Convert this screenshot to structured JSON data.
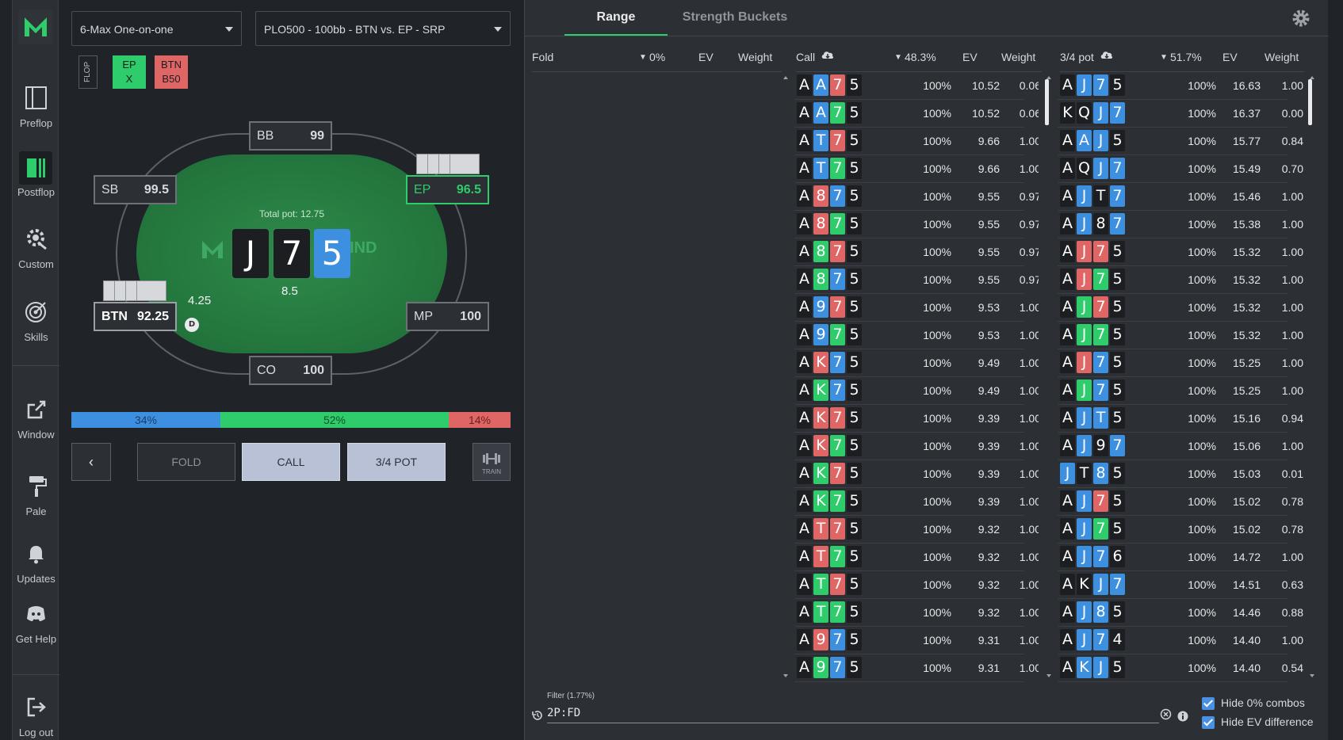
{
  "sidebar": {
    "items": [
      {
        "label": "Preflop",
        "icon": "book-icon"
      },
      {
        "label": "Postflop",
        "icon": "postflop-icon"
      },
      {
        "label": "Custom",
        "icon": "custom-gear-icon"
      },
      {
        "label": "Skills",
        "icon": "target-icon"
      },
      {
        "label": "Window",
        "icon": "external-window-icon"
      },
      {
        "label": "Pale",
        "icon": "paint-roller-icon"
      },
      {
        "label": "Updates",
        "icon": "bell-icon"
      },
      {
        "label": "Get Help",
        "icon": "discord-icon"
      },
      {
        "label": "Log out",
        "icon": "logout-icon"
      }
    ]
  },
  "selectors": {
    "game": "6-Max One-on-one",
    "spot": "PLO500 - 100bb - BTN vs. EP - SRP"
  },
  "street_tag": "FLOP",
  "action_tags": [
    {
      "line1": "EP",
      "line2": "X",
      "color": "#2ecc6a"
    },
    {
      "line1": "BTN",
      "line2": "B50",
      "color": "#e06666"
    }
  ],
  "table": {
    "logo_text": "IND",
    "pot_label": "Total pot: 12.75",
    "main_bet": "8.5",
    "btn_bet": "4.25",
    "dealer_label": "D",
    "seats": {
      "bb": {
        "name": "BB",
        "stack": "99"
      },
      "sb": {
        "name": "SB",
        "stack": "99.5"
      },
      "ep": {
        "name": "EP",
        "stack": "96.5"
      },
      "btn": {
        "name": "BTN",
        "stack": "92.25"
      },
      "mp": {
        "name": "MP",
        "stack": "100"
      },
      "co": {
        "name": "CO",
        "stack": "100"
      }
    },
    "board": [
      {
        "rank": "J",
        "color": "#1c1e21"
      },
      {
        "rank": "7",
        "color": "#1c1e21"
      },
      {
        "rank": "5",
        "color": "#3d8fe0"
      }
    ]
  },
  "frequency": [
    {
      "label": "34%",
      "value": 34,
      "color": "#3d8fe0",
      "text_color": "#1b3d66"
    },
    {
      "label": "52%",
      "value": 52,
      "color": "#2ecc6a",
      "text_color": "#13502a"
    },
    {
      "label": "14%",
      "value": 14,
      "color": "#e06666",
      "text_color": "#6a1f1f"
    }
  ],
  "actions": {
    "fold": "FOLD",
    "call": "CALL",
    "bet": "3/4 POT",
    "train": "TRAIN"
  },
  "tabs": {
    "range": "Range",
    "buckets": "Strength Buckets"
  },
  "columns": {
    "fold": {
      "title": "Fold",
      "freq": "0%",
      "ev": "EV",
      "weight": "Weight"
    },
    "call": {
      "title": "Call",
      "freq": "48.3%",
      "ev": "EV",
      "weight": "Weight"
    },
    "bet": {
      "title": "3/4 pot",
      "freq": "51.7%",
      "ev": "EV",
      "weight": "Weight"
    }
  },
  "suit_colors": {
    "s": "#1c1e21",
    "h": "#e06666",
    "d": "#3d8fe0",
    "c": "#2ecc6a"
  },
  "call_rows": [
    {
      "cards": [
        [
          "A",
          "s"
        ],
        [
          "A",
          "d"
        ],
        [
          "7",
          "h"
        ],
        [
          "5",
          "s"
        ]
      ],
      "freq": "100%",
      "ev": "10.52",
      "weight": "0.06"
    },
    {
      "cards": [
        [
          "A",
          "s"
        ],
        [
          "A",
          "d"
        ],
        [
          "7",
          "c"
        ],
        [
          "5",
          "s"
        ]
      ],
      "freq": "100%",
      "ev": "10.52",
      "weight": "0.06"
    },
    {
      "cards": [
        [
          "A",
          "s"
        ],
        [
          "T",
          "d"
        ],
        [
          "7",
          "h"
        ],
        [
          "5",
          "s"
        ]
      ],
      "freq": "100%",
      "ev": "9.66",
      "weight": "1.00"
    },
    {
      "cards": [
        [
          "A",
          "s"
        ],
        [
          "T",
          "d"
        ],
        [
          "7",
          "c"
        ],
        [
          "5",
          "s"
        ]
      ],
      "freq": "100%",
      "ev": "9.66",
      "weight": "1.00"
    },
    {
      "cards": [
        [
          "A",
          "s"
        ],
        [
          "8",
          "h"
        ],
        [
          "7",
          "d"
        ],
        [
          "5",
          "s"
        ]
      ],
      "freq": "100%",
      "ev": "9.55",
      "weight": "0.97"
    },
    {
      "cards": [
        [
          "A",
          "s"
        ],
        [
          "8",
          "h"
        ],
        [
          "7",
          "c"
        ],
        [
          "5",
          "s"
        ]
      ],
      "freq": "100%",
      "ev": "9.55",
      "weight": "0.97"
    },
    {
      "cards": [
        [
          "A",
          "s"
        ],
        [
          "8",
          "c"
        ],
        [
          "7",
          "h"
        ],
        [
          "5",
          "s"
        ]
      ],
      "freq": "100%",
      "ev": "9.55",
      "weight": "0.97"
    },
    {
      "cards": [
        [
          "A",
          "s"
        ],
        [
          "8",
          "c"
        ],
        [
          "7",
          "d"
        ],
        [
          "5",
          "s"
        ]
      ],
      "freq": "100%",
      "ev": "9.55",
      "weight": "0.97"
    },
    {
      "cards": [
        [
          "A",
          "s"
        ],
        [
          "9",
          "d"
        ],
        [
          "7",
          "h"
        ],
        [
          "5",
          "s"
        ]
      ],
      "freq": "100%",
      "ev": "9.53",
      "weight": "1.00"
    },
    {
      "cards": [
        [
          "A",
          "s"
        ],
        [
          "9",
          "d"
        ],
        [
          "7",
          "c"
        ],
        [
          "5",
          "s"
        ]
      ],
      "freq": "100%",
      "ev": "9.53",
      "weight": "1.00"
    },
    {
      "cards": [
        [
          "A",
          "s"
        ],
        [
          "K",
          "h"
        ],
        [
          "7",
          "d"
        ],
        [
          "5",
          "s"
        ]
      ],
      "freq": "100%",
      "ev": "9.49",
      "weight": "1.00"
    },
    {
      "cards": [
        [
          "A",
          "s"
        ],
        [
          "K",
          "c"
        ],
        [
          "7",
          "d"
        ],
        [
          "5",
          "s"
        ]
      ],
      "freq": "100%",
      "ev": "9.49",
      "weight": "1.00"
    },
    {
      "cards": [
        [
          "A",
          "s"
        ],
        [
          "K",
          "h"
        ],
        [
          "7",
          "h"
        ],
        [
          "5",
          "s"
        ]
      ],
      "freq": "100%",
      "ev": "9.39",
      "weight": "1.00"
    },
    {
      "cards": [
        [
          "A",
          "s"
        ],
        [
          "K",
          "h"
        ],
        [
          "7",
          "c"
        ],
        [
          "5",
          "s"
        ]
      ],
      "freq": "100%",
      "ev": "9.39",
      "weight": "1.00"
    },
    {
      "cards": [
        [
          "A",
          "s"
        ],
        [
          "K",
          "c"
        ],
        [
          "7",
          "h"
        ],
        [
          "5",
          "s"
        ]
      ],
      "freq": "100%",
      "ev": "9.39",
      "weight": "1.00"
    },
    {
      "cards": [
        [
          "A",
          "s"
        ],
        [
          "K",
          "c"
        ],
        [
          "7",
          "c"
        ],
        [
          "5",
          "s"
        ]
      ],
      "freq": "100%",
      "ev": "9.39",
      "weight": "1.00"
    },
    {
      "cards": [
        [
          "A",
          "s"
        ],
        [
          "T",
          "h"
        ],
        [
          "7",
          "h"
        ],
        [
          "5",
          "s"
        ]
      ],
      "freq": "100%",
      "ev": "9.32",
      "weight": "1.00"
    },
    {
      "cards": [
        [
          "A",
          "s"
        ],
        [
          "T",
          "h"
        ],
        [
          "7",
          "c"
        ],
        [
          "5",
          "s"
        ]
      ],
      "freq": "100%",
      "ev": "9.32",
      "weight": "1.00"
    },
    {
      "cards": [
        [
          "A",
          "s"
        ],
        [
          "T",
          "c"
        ],
        [
          "7",
          "h"
        ],
        [
          "5",
          "s"
        ]
      ],
      "freq": "100%",
      "ev": "9.32",
      "weight": "1.00"
    },
    {
      "cards": [
        [
          "A",
          "s"
        ],
        [
          "T",
          "c"
        ],
        [
          "7",
          "c"
        ],
        [
          "5",
          "s"
        ]
      ],
      "freq": "100%",
      "ev": "9.32",
      "weight": "1.00"
    },
    {
      "cards": [
        [
          "A",
          "s"
        ],
        [
          "9",
          "h"
        ],
        [
          "7",
          "d"
        ],
        [
          "5",
          "s"
        ]
      ],
      "freq": "100%",
      "ev": "9.31",
      "weight": "1.00"
    },
    {
      "cards": [
        [
          "A",
          "s"
        ],
        [
          "9",
          "c"
        ],
        [
          "7",
          "d"
        ],
        [
          "5",
          "s"
        ]
      ],
      "freq": "100%",
      "ev": "9.31",
      "weight": "1.00"
    }
  ],
  "bet_rows": [
    {
      "cards": [
        [
          "A",
          "s"
        ],
        [
          "J",
          "d"
        ],
        [
          "7",
          "d"
        ],
        [
          "5",
          "s"
        ]
      ],
      "freq": "100%",
      "ev": "16.63",
      "weight": "1.00"
    },
    {
      "cards": [
        [
          "K",
          "s"
        ],
        [
          "Q",
          "s"
        ],
        [
          "J",
          "d"
        ],
        [
          "7",
          "d"
        ]
      ],
      "freq": "100%",
      "ev": "16.37",
      "weight": "0.00"
    },
    {
      "cards": [
        [
          "A",
          "s"
        ],
        [
          "A",
          "d"
        ],
        [
          "J",
          "d"
        ],
        [
          "5",
          "s"
        ]
      ],
      "freq": "100%",
      "ev": "15.77",
      "weight": "0.84"
    },
    {
      "cards": [
        [
          "A",
          "s"
        ],
        [
          "Q",
          "s"
        ],
        [
          "J",
          "d"
        ],
        [
          "7",
          "d"
        ]
      ],
      "freq": "100%",
      "ev": "15.49",
      "weight": "0.70"
    },
    {
      "cards": [
        [
          "A",
          "s"
        ],
        [
          "J",
          "d"
        ],
        [
          "T",
          "s"
        ],
        [
          "7",
          "d"
        ]
      ],
      "freq": "100%",
      "ev": "15.46",
      "weight": "1.00"
    },
    {
      "cards": [
        [
          "A",
          "s"
        ],
        [
          "J",
          "d"
        ],
        [
          "8",
          "s"
        ],
        [
          "7",
          "d"
        ]
      ],
      "freq": "100%",
      "ev": "15.38",
      "weight": "1.00"
    },
    {
      "cards": [
        [
          "A",
          "s"
        ],
        [
          "J",
          "h"
        ],
        [
          "7",
          "h"
        ],
        [
          "5",
          "s"
        ]
      ],
      "freq": "100%",
      "ev": "15.32",
      "weight": "1.00"
    },
    {
      "cards": [
        [
          "A",
          "s"
        ],
        [
          "J",
          "h"
        ],
        [
          "7",
          "c"
        ],
        [
          "5",
          "s"
        ]
      ],
      "freq": "100%",
      "ev": "15.32",
      "weight": "1.00"
    },
    {
      "cards": [
        [
          "A",
          "s"
        ],
        [
          "J",
          "c"
        ],
        [
          "7",
          "h"
        ],
        [
          "5",
          "s"
        ]
      ],
      "freq": "100%",
      "ev": "15.32",
      "weight": "1.00"
    },
    {
      "cards": [
        [
          "A",
          "s"
        ],
        [
          "J",
          "c"
        ],
        [
          "7",
          "c"
        ],
        [
          "5",
          "s"
        ]
      ],
      "freq": "100%",
      "ev": "15.32",
      "weight": "1.00"
    },
    {
      "cards": [
        [
          "A",
          "s"
        ],
        [
          "J",
          "h"
        ],
        [
          "7",
          "d"
        ],
        [
          "5",
          "s"
        ]
      ],
      "freq": "100%",
      "ev": "15.25",
      "weight": "1.00"
    },
    {
      "cards": [
        [
          "A",
          "s"
        ],
        [
          "J",
          "c"
        ],
        [
          "7",
          "d"
        ],
        [
          "5",
          "s"
        ]
      ],
      "freq": "100%",
      "ev": "15.25",
      "weight": "1.00"
    },
    {
      "cards": [
        [
          "A",
          "s"
        ],
        [
          "J",
          "d"
        ],
        [
          "T",
          "d"
        ],
        [
          "5",
          "s"
        ]
      ],
      "freq": "100%",
      "ev": "15.16",
      "weight": "0.94"
    },
    {
      "cards": [
        [
          "A",
          "s"
        ],
        [
          "J",
          "d"
        ],
        [
          "9",
          "s"
        ],
        [
          "7",
          "d"
        ]
      ],
      "freq": "100%",
      "ev": "15.06",
      "weight": "1.00"
    },
    {
      "cards": [
        [
          "J",
          "d"
        ],
        [
          "T",
          "s"
        ],
        [
          "8",
          "d"
        ],
        [
          "5",
          "s"
        ]
      ],
      "freq": "100%",
      "ev": "15.03",
      "weight": "0.01"
    },
    {
      "cards": [
        [
          "A",
          "s"
        ],
        [
          "J",
          "d"
        ],
        [
          "7",
          "h"
        ],
        [
          "5",
          "s"
        ]
      ],
      "freq": "100%",
      "ev": "15.02",
      "weight": "0.78"
    },
    {
      "cards": [
        [
          "A",
          "s"
        ],
        [
          "J",
          "d"
        ],
        [
          "7",
          "c"
        ],
        [
          "5",
          "s"
        ]
      ],
      "freq": "100%",
      "ev": "15.02",
      "weight": "0.78"
    },
    {
      "cards": [
        [
          "A",
          "s"
        ],
        [
          "J",
          "d"
        ],
        [
          "7",
          "d"
        ],
        [
          "6",
          "s"
        ]
      ],
      "freq": "100%",
      "ev": "14.72",
      "weight": "1.00"
    },
    {
      "cards": [
        [
          "A",
          "s"
        ],
        [
          "K",
          "s"
        ],
        [
          "J",
          "d"
        ],
        [
          "7",
          "d"
        ]
      ],
      "freq": "100%",
      "ev": "14.51",
      "weight": "0.63"
    },
    {
      "cards": [
        [
          "A",
          "s"
        ],
        [
          "J",
          "d"
        ],
        [
          "8",
          "d"
        ],
        [
          "5",
          "s"
        ]
      ],
      "freq": "100%",
      "ev": "14.46",
      "weight": "0.88"
    },
    {
      "cards": [
        [
          "A",
          "s"
        ],
        [
          "J",
          "d"
        ],
        [
          "7",
          "d"
        ],
        [
          "4",
          "s"
        ]
      ],
      "freq": "100%",
      "ev": "14.40",
      "weight": "1.00"
    },
    {
      "cards": [
        [
          "A",
          "s"
        ],
        [
          "K",
          "d"
        ],
        [
          "J",
          "d"
        ],
        [
          "5",
          "s"
        ]
      ],
      "freq": "100%",
      "ev": "14.40",
      "weight": "0.54"
    }
  ],
  "filter": {
    "label": "Filter (1.77%)",
    "value": "2P:FD"
  },
  "options": {
    "hide_zero": "Hide 0% combos",
    "hide_ev": "Hide EV difference"
  }
}
